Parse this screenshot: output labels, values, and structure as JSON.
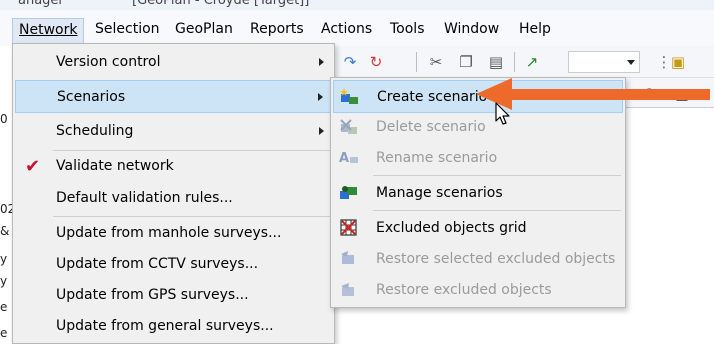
{
  "window": {
    "title_left": "anager",
    "title_right": "[GeoPlan - Croyde [Target]]"
  },
  "menubar": {
    "items": [
      {
        "label": "Network",
        "active": true
      },
      {
        "label": "Selection"
      },
      {
        "label": "GeoPlan"
      },
      {
        "label": "Reports"
      },
      {
        "label": "Actions"
      },
      {
        "label": "Tools"
      },
      {
        "label": "Window"
      },
      {
        "label": "Help"
      }
    ]
  },
  "network_menu": {
    "items": [
      {
        "label": "Version control",
        "submenu": true
      },
      {
        "label": "Scenarios",
        "submenu": true,
        "highlighted": true
      },
      {
        "label": "Scheduling",
        "submenu": true
      },
      {
        "label": "Validate network",
        "checked": true
      },
      {
        "label": "Default validation rules..."
      },
      {
        "label": "Update from manhole surveys..."
      },
      {
        "label": "Update from CCTV surveys..."
      },
      {
        "label": "Update from GPS surveys..."
      },
      {
        "label": "Update from general surveys..."
      }
    ]
  },
  "scenarios_menu": {
    "items": [
      {
        "label": "Create scenario",
        "icon": "create-scenario-icon",
        "highlighted": true
      },
      {
        "label": "Delete scenario",
        "icon": "delete-scenario-icon",
        "disabled": true
      },
      {
        "label": "Rename scenario",
        "icon": "rename-scenario-icon",
        "disabled": true
      },
      {
        "label": "Manage scenarios",
        "icon": "manage-scenarios-icon"
      },
      {
        "label": "Excluded objects grid",
        "icon": "excluded-objects-grid-icon"
      },
      {
        "label": "Restore selected excluded objects",
        "icon": "restore-selected-icon",
        "disabled": true
      },
      {
        "label": "Restore excluded objects",
        "icon": "restore-excluded-icon",
        "disabled": true
      }
    ]
  },
  "left_edge": {
    "glyphs": [
      "0",
      "02",
      "&",
      "y",
      "y",
      "e",
      "e"
    ]
  },
  "colors": {
    "highlight": "#cde4f7",
    "menu_bg": "#f0f0f0",
    "callout_arrow": "#ee6a2b",
    "check": "#c8102e"
  }
}
